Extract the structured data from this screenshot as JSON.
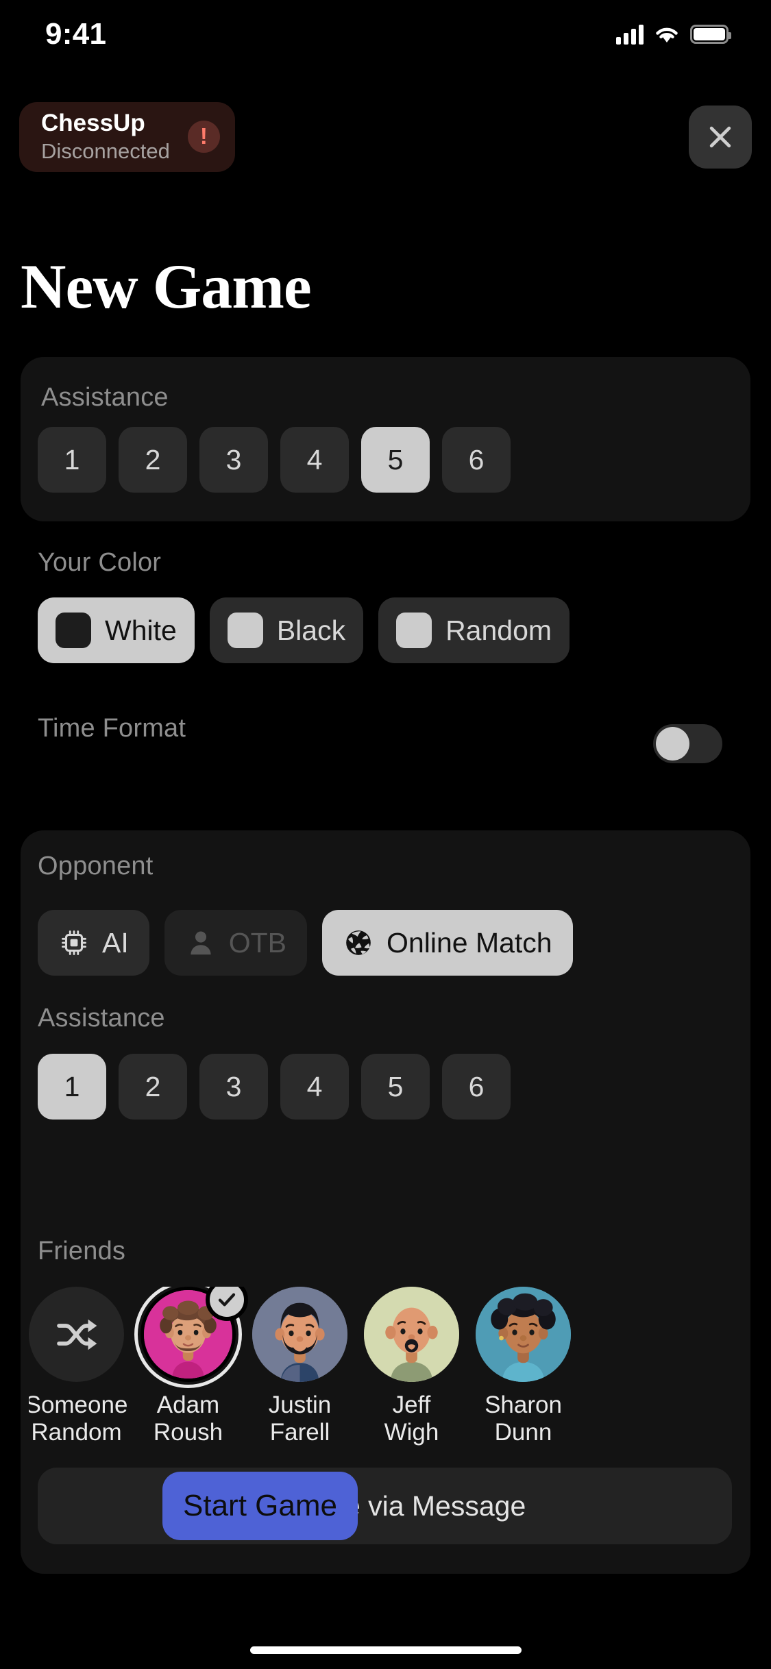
{
  "status_bar": {
    "time": "9:41",
    "signal_icon": "cellular-signal-icon",
    "wifi_icon": "wifi-icon",
    "battery_icon": "battery-icon"
  },
  "connection_banner": {
    "device_name": "ChessUp",
    "status": "Disconnected",
    "alert_icon": "exclamation-icon",
    "background_color": "#2a1512",
    "alert_color": "#ff7b6b"
  },
  "close_button": {
    "icon": "close-icon",
    "label": "Close"
  },
  "page": {
    "title": "New Game"
  },
  "settings_card": {
    "assistance": {
      "label": "Assistance",
      "levels": [
        "1",
        "2",
        "3",
        "4",
        "5",
        "6"
      ],
      "selected": "5"
    },
    "your_color": {
      "label": "Your Color",
      "options": [
        {
          "label": "White",
          "selected": true
        },
        {
          "label": "Black",
          "selected": false
        },
        {
          "label": "Random",
          "selected": false
        }
      ]
    },
    "time_format": {
      "label": "Time Format",
      "enabled": false
    }
  },
  "opponent_card": {
    "opponent": {
      "label": "Opponent",
      "options": [
        {
          "label": "AI",
          "icon": "chip-icon",
          "selected": false,
          "disabled": false
        },
        {
          "label": "OTB",
          "icon": "person-icon",
          "selected": false,
          "disabled": true
        },
        {
          "label": "Online Match",
          "icon": "globe-icon",
          "selected": true,
          "disabled": false
        }
      ]
    },
    "assistance": {
      "label": "Assistance",
      "levels": [
        "1",
        "2",
        "3",
        "4",
        "5",
        "6"
      ],
      "selected": "1"
    },
    "friends": {
      "label": "Friends",
      "items": [
        {
          "name_line1": "Someone",
          "name_line2": "Random",
          "icon": "shuffle-icon",
          "avatar_color": "#252525",
          "selected": false,
          "type": "random"
        },
        {
          "name_line1": "Adam",
          "name_line2": "Roush",
          "avatar_color": "#d8329a",
          "selected": true,
          "type": "avatar",
          "hair": "#6b4430",
          "skin": "#dda07a",
          "shirt": "#d8329a"
        },
        {
          "name_line1": "Justin",
          "name_line2": "Farell",
          "avatar_color": "#737c96",
          "selected": false,
          "type": "avatar",
          "hair": "#17171c",
          "skin": "#e09a72",
          "shirt": "#2c4468"
        },
        {
          "name_line1": "Jeff",
          "name_line2": "Wigh",
          "avatar_color": "#d4dab0",
          "selected": false,
          "type": "avatar",
          "hair": "#e09a72",
          "skin": "#e09a72",
          "shirt": "#8d9b74"
        },
        {
          "name_line1": "Sharon",
          "name_line2": "Dunn",
          "avatar_color": "#4f9cb5",
          "selected": false,
          "type": "avatar",
          "hair": "#14141a",
          "skin": "#c07d50",
          "shirt": "#5eb4cc"
        }
      ]
    },
    "invite": {
      "label": "Invite via Message",
      "icon": "envelope-icon"
    }
  },
  "start_button": {
    "label": "Start Game",
    "color": "#4e62d6"
  }
}
